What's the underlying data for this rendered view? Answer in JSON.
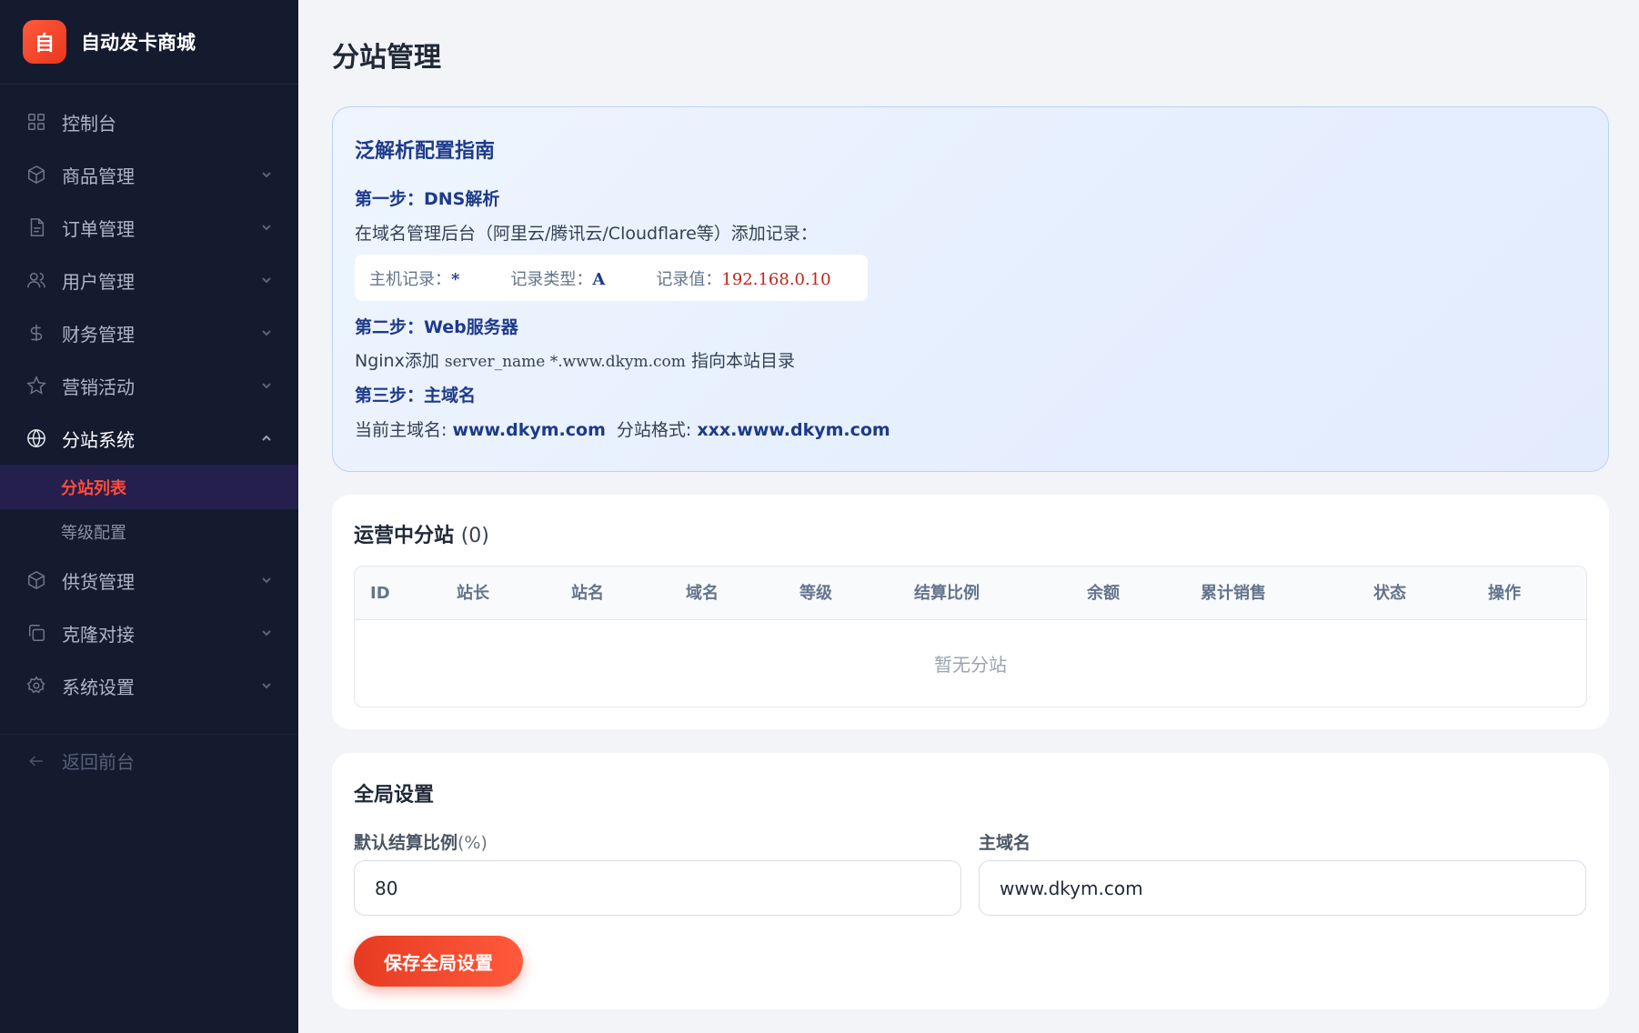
{
  "brand": {
    "logo_char": "自",
    "name": "自动发卡商城"
  },
  "sidebar": {
    "items": [
      {
        "label": "控制台",
        "icon": "dashboard-icon",
        "expandable": false
      },
      {
        "label": "商品管理",
        "icon": "box-icon",
        "expandable": true
      },
      {
        "label": "订单管理",
        "icon": "document-icon",
        "expandable": true
      },
      {
        "label": "用户管理",
        "icon": "users-icon",
        "expandable": true
      },
      {
        "label": "财务管理",
        "icon": "dollar-icon",
        "expandable": true
      },
      {
        "label": "营销活动",
        "icon": "star-icon",
        "expandable": true
      },
      {
        "label": "分站系统",
        "icon": "globe-icon",
        "expandable": true,
        "expanded": true
      },
      {
        "label": "供货管理",
        "icon": "box-icon",
        "expandable": true
      },
      {
        "label": "克隆对接",
        "icon": "copy-icon",
        "expandable": true
      },
      {
        "label": "系统设置",
        "icon": "gear-icon",
        "expandable": true
      }
    ],
    "subitems": [
      {
        "label": "分站列表",
        "active": true
      },
      {
        "label": "等级配置",
        "active": false
      }
    ],
    "back_label": "返回前台"
  },
  "page": {
    "title": "分站管理"
  },
  "guide": {
    "title": "泛解析配置指南",
    "step1_title": "第一步：DNS解析",
    "step1_text": "在域名管理后台（阿里云/腾讯云/Cloudflare等）添加记录：",
    "record": {
      "host_label": "主机记录：",
      "host_value": "*",
      "type_label": "记录类型：",
      "type_value": "A",
      "value_label": "记录值：",
      "value_value": "192.168.0.10"
    },
    "step2_title": "第二步：Web服务器",
    "step2_prefix": "Nginx添加 ",
    "step2_code": "server_name *.www.dkym.com",
    "step2_suffix": " 指向本站目录",
    "step3_title": "第三步：主域名",
    "step3_main_label": "当前主域名: ",
    "step3_main_value": "www.dkym.com",
    "step3_format_label": "分站格式: ",
    "step3_format_value": "xxx.www.dkym.com"
  },
  "sites": {
    "title": "运营中分站",
    "count": "(0)",
    "columns": [
      "ID",
      "站长",
      "站名",
      "域名",
      "等级",
      "结算比例",
      "余额",
      "累计销售",
      "状态",
      "操作"
    ],
    "empty_text": "暂无分站"
  },
  "settings": {
    "title": "全局设置",
    "ratio_label": "默认结算比例",
    "ratio_unit": "(%)",
    "ratio_value": "80",
    "domain_label": "主域名",
    "domain_value": "www.dkym.com",
    "save_label": "保存全局设置"
  },
  "colors": {
    "accent": "#ff4c3b",
    "sidebar_bg": "#141b2f",
    "guide_text": "#1d3a8a"
  }
}
